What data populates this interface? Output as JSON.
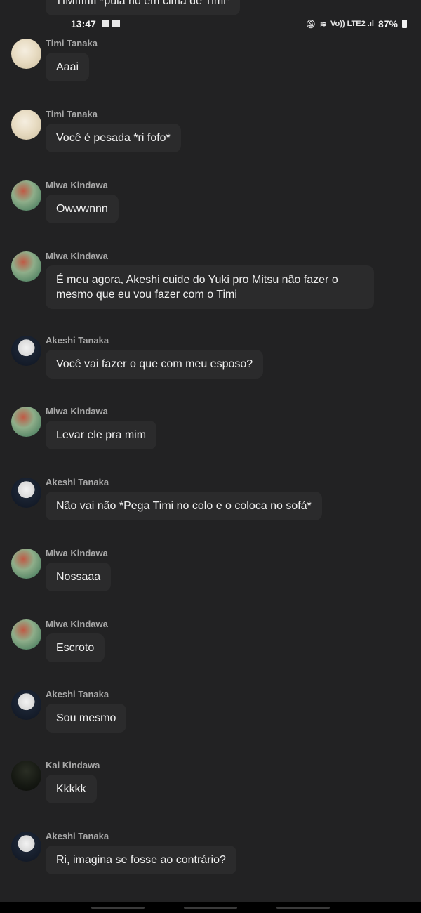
{
  "status": {
    "time": "13:47",
    "signal": "Vo)) LTE2 .ıl",
    "battery": "87%"
  },
  "top_partial_message": "TIMIIIIIII *pula no em cima de Timi*",
  "messages": [
    {
      "sender": "Timi Tanaka",
      "avatar": "timi-avatar",
      "text": "Aaai"
    },
    {
      "sender": "Timi Tanaka",
      "avatar": "timi-avatar",
      "text": "Você é pesada *ri fofo*"
    },
    {
      "sender": "Miwa Kindawa",
      "avatar": "miwa-avatar",
      "text": "Owwwnnn"
    },
    {
      "sender": "Miwa Kindawa",
      "avatar": "miwa-avatar",
      "text": "É meu agora, Akeshi cuide do Yuki pro Mitsu não fazer o mesmo que eu vou fazer com o Timi"
    },
    {
      "sender": "Akeshi Tanaka",
      "avatar": "akeshi-avatar",
      "text": "Você vai fazer o que com meu esposo?"
    },
    {
      "sender": "Miwa Kindawa",
      "avatar": "miwa-avatar",
      "text": "Levar ele pra mim"
    },
    {
      "sender": "Akeshi Tanaka",
      "avatar": "akeshi-avatar",
      "text": "Não vai não *Pega Timi no colo e o coloca no sofá*"
    },
    {
      "sender": "Miwa Kindawa",
      "avatar": "miwa-avatar",
      "text": "Nossaaa"
    },
    {
      "sender": "Miwa Kindawa",
      "avatar": "miwa-avatar",
      "text": "Escroto"
    },
    {
      "sender": "Akeshi Tanaka",
      "avatar": "akeshi-avatar",
      "text": "Sou mesmo"
    },
    {
      "sender": "Kai Kindawa",
      "avatar": "kai-avatar",
      "text": "Kkkkk"
    },
    {
      "sender": "Akeshi Tanaka",
      "avatar": "akeshi-avatar",
      "text": "Ri, imagina se fosse ao contrário?"
    }
  ]
}
